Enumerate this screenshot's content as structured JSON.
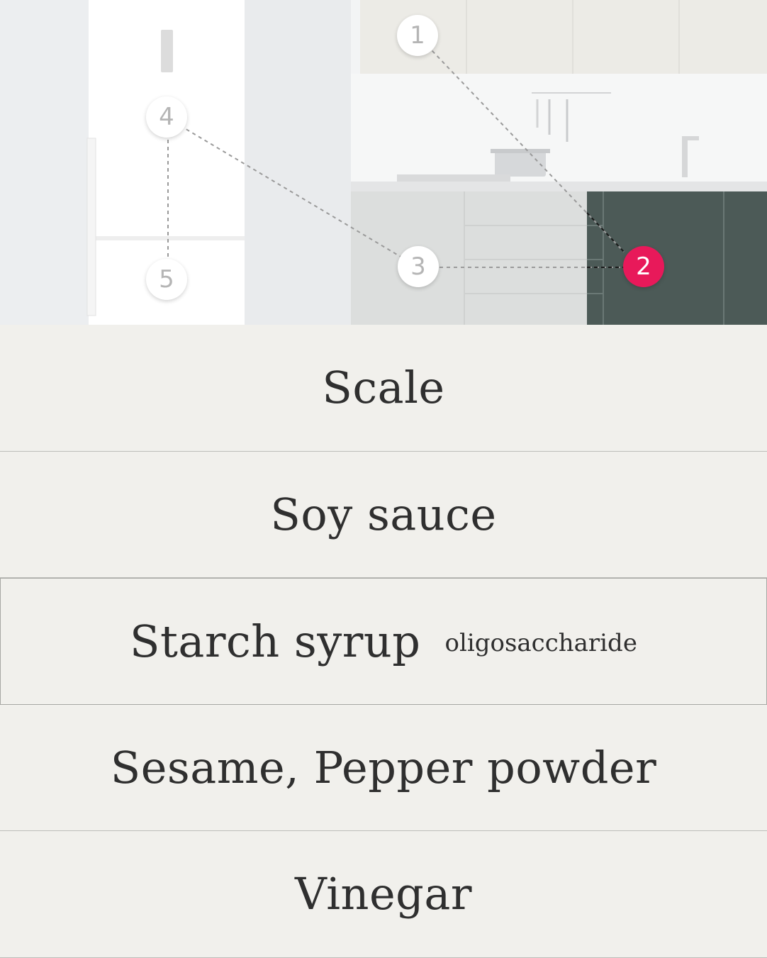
{
  "hero": {
    "markers": [
      {
        "number": "1",
        "active": false
      },
      {
        "number": "2",
        "active": true
      },
      {
        "number": "3",
        "active": false
      },
      {
        "number": "4",
        "active": false
      },
      {
        "number": "5",
        "active": false
      }
    ],
    "colors": {
      "active_marker": "#e8195a",
      "inactive_text": "#b5b5b5",
      "cabinet_dark": "#4c5a57"
    }
  },
  "items": [
    {
      "label": "Scale",
      "sub": ""
    },
    {
      "label": "Soy sauce",
      "sub": ""
    },
    {
      "label": "Starch syrup",
      "sub": "oligosaccharide",
      "selected": true
    },
    {
      "label": "Sesame, Pepper powder",
      "sub": ""
    },
    {
      "label": "Vinegar",
      "sub": ""
    }
  ]
}
